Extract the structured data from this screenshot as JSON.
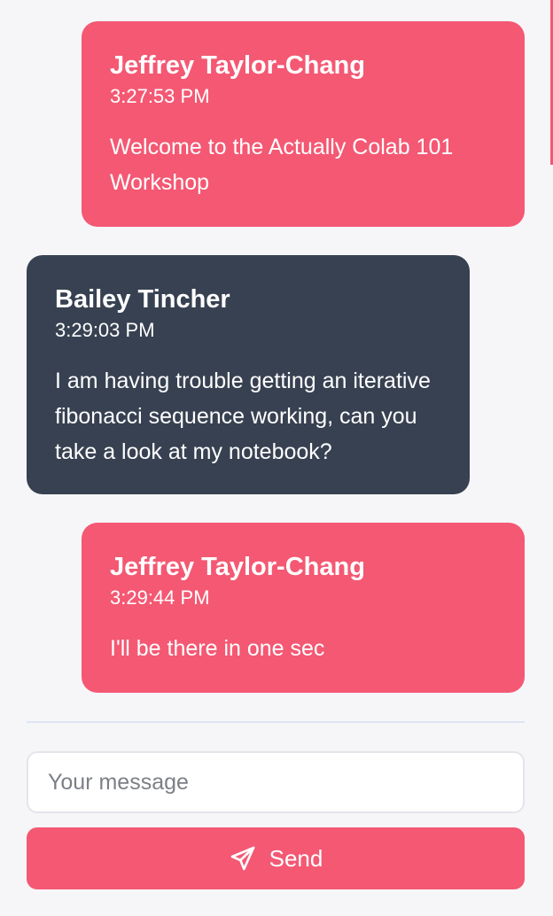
{
  "messages": [
    {
      "author": "Jeffrey Taylor-Chang",
      "time": "3:27:53 PM",
      "text": "Welcome to the Actually Colab 101 Workshop",
      "side": "self"
    },
    {
      "author": "Bailey Tincher",
      "time": "3:29:03 PM",
      "text": "I am having trouble getting an iterative fibonacci sequence working, can you take a look at my notebook?",
      "side": "other"
    },
    {
      "author": "Jeffrey Taylor-Chang",
      "time": "3:29:44 PM",
      "text": "I'll be there in one sec",
      "side": "self"
    }
  ],
  "composer": {
    "placeholder": "Your message",
    "value": "",
    "send_label": "Send",
    "send_icon": "paper-plane-icon"
  },
  "colors": {
    "self_bubble": "#f45873",
    "other_bubble": "#374151",
    "background": "#f6f6f9",
    "accent": "#f45873"
  }
}
